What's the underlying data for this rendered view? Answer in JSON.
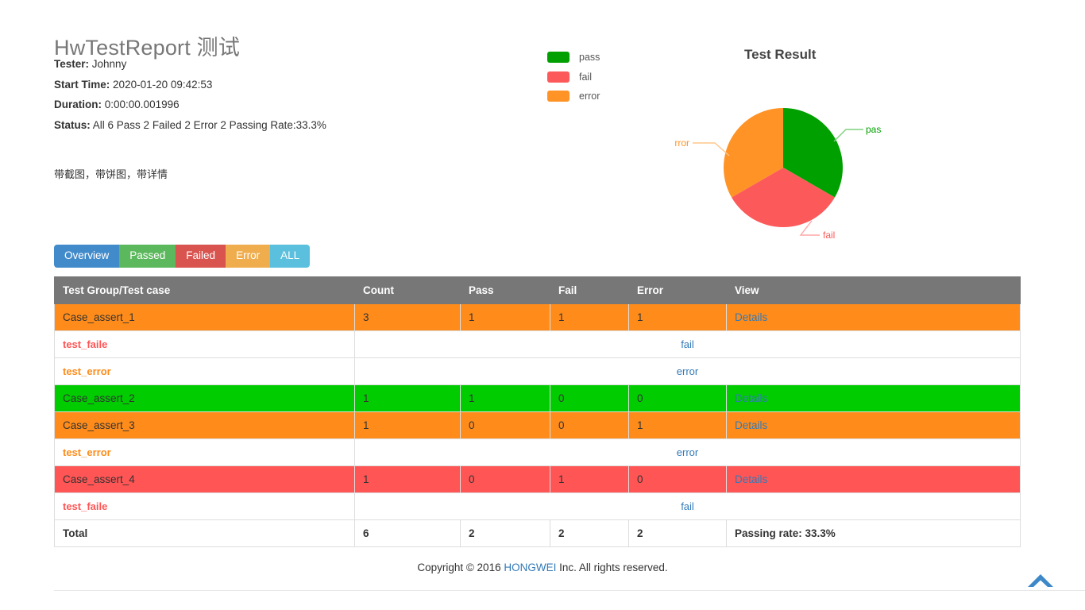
{
  "report": {
    "title": "HwTestReport 测试",
    "description": "带截图，带饼图，带详情",
    "meta": [
      {
        "key": "Tester:",
        "value": "Johnny"
      },
      {
        "key": "Start Time:",
        "value": "2020-01-20 09:42:53"
      },
      {
        "key": "Duration:",
        "value": "0:00:00.001996"
      },
      {
        "key": "Status:",
        "value": "All 6 Pass 2 Failed 2 Error 2 Passing Rate:33.3%"
      }
    ]
  },
  "legend": {
    "items": [
      {
        "label": "pass",
        "color": "#00a000"
      },
      {
        "label": "fail",
        "color": "#fc5a5a"
      },
      {
        "label": "error",
        "color": "#ff9326"
      }
    ]
  },
  "chart_data": {
    "type": "pie",
    "title": "Test Result",
    "labels": [
      "pass",
      "fail",
      "error"
    ],
    "values": [
      2,
      2,
      2
    ],
    "percentages": [
      33.3,
      33.3,
      33.3
    ],
    "colors": [
      "#00a000",
      "#fc5a5a",
      "#ff9326"
    ],
    "legend_position": "left",
    "annotations": [
      {
        "text": "pass",
        "position": "right"
      },
      {
        "text": "fail",
        "position": "bottom-right"
      },
      {
        "text": "error",
        "position": "left"
      }
    ]
  },
  "tabs": [
    {
      "label": "Overview",
      "color": "#428bca",
      "active": true
    },
    {
      "label": "Passed",
      "color": "#5cb85c",
      "active": false
    },
    {
      "label": "Failed",
      "color": "#d9534f",
      "active": false
    },
    {
      "label": "Error",
      "color": "#f0ad4e",
      "active": false
    },
    {
      "label": "ALL",
      "color": "#5bc0de",
      "active": false
    }
  ],
  "table": {
    "columns": [
      "Test Group/Test case",
      "Count",
      "Pass",
      "Fail",
      "Error",
      "View"
    ],
    "details_label": "Details",
    "rows": [
      {
        "kind": "group",
        "status": "error",
        "name": "Case_assert_1",
        "count": "3",
        "pass": "1",
        "fail": "1",
        "error": "1",
        "view": "Details"
      },
      {
        "kind": "sub",
        "status": "fail",
        "name": "test_faile",
        "result": "fail"
      },
      {
        "kind": "sub",
        "status": "error",
        "name": "test_error",
        "result": "error"
      },
      {
        "kind": "group",
        "status": "pass",
        "name": "Case_assert_2",
        "count": "1",
        "pass": "1",
        "fail": "0",
        "error": "0",
        "view": "Details"
      },
      {
        "kind": "group",
        "status": "error",
        "name": "Case_assert_3",
        "count": "1",
        "pass": "0",
        "fail": "0",
        "error": "1",
        "view": "Details"
      },
      {
        "kind": "sub",
        "status": "error",
        "name": "test_error",
        "result": "error"
      },
      {
        "kind": "group",
        "status": "fail",
        "name": "Case_assert_4",
        "count": "1",
        "pass": "0",
        "fail": "1",
        "error": "0",
        "view": "Details"
      },
      {
        "kind": "sub",
        "status": "fail",
        "name": "test_faile",
        "result": "fail"
      }
    ],
    "total": {
      "label": "Total",
      "count": "6",
      "pass": "2",
      "fail": "2",
      "error": "2",
      "view": "Passing rate: 33.3%"
    }
  },
  "footer": {
    "prefix": "Copyright © 2016 ",
    "link": "HONGWEI",
    "suffix": " Inc. All rights reserved."
  },
  "back_to_top": {
    "icon": "chevron-up-icon",
    "color": "#3d88c8"
  }
}
